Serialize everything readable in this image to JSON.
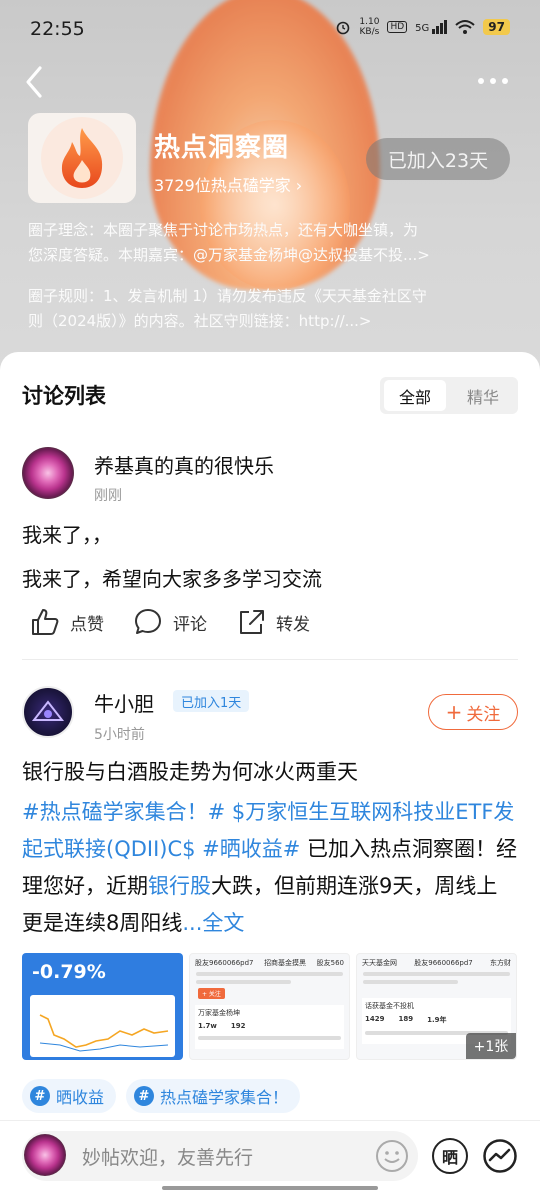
{
  "status_bar": {
    "time": "22:55",
    "speed_value": "1.10",
    "speed_unit": "KB/s",
    "network": "5G",
    "battery": "97"
  },
  "header": {
    "circle_name": "热点洞察圈",
    "members": "3729位热点磕学家 ›",
    "joined": "已加入23天",
    "concept_line1": "圈子理念：本圈子聚焦于讨论市场热点，还有大咖坐镇，为",
    "concept_line2": "您深度答疑。本期嘉宾：@万家基金杨坤@达叔投基不投...>",
    "rules_line1": "圈子规则：1、发言机制 1）请勿发布违反《天天基金社区守",
    "rules_line2": "则（2024版）》的内容。社区守则链接：http://...>"
  },
  "discussion": {
    "title": "讨论列表",
    "tabs": [
      "全部",
      "精华"
    ],
    "active_tab": "全部"
  },
  "post1": {
    "author": "养基真的真的很快乐",
    "time": "刚刚",
    "line1": "我来了，，",
    "line2": "我来了，希望向大家多多学习交流",
    "actions": {
      "like": "点赞",
      "comment": "评论",
      "share": "转发"
    }
  },
  "post2": {
    "author": "牛小胆",
    "badge": "已加入1天",
    "follow": "关注",
    "time": "5小时前",
    "title": "银行股与白酒股走势为何冰火两重天",
    "seg1": "#热点磕学家集合！# $万家恒生互联网科技业ETF发起式联接(QDII)C$ #晒收益#",
    "seg2": " 已加入热点洞察圈！经理您好，近期",
    "seg3": "银行股",
    "seg4": "大跌，但前期连涨9天，周线上更是连续8周阳线",
    "more_link": "...全文",
    "thumb1_value": "-0.79%",
    "image_count": "+1张",
    "tags": [
      "晒收益",
      "热点磕学家集合！"
    ]
  },
  "thumb_text": {
    "t2_user": "股友9660066pd7",
    "t2_col2": "招商基金摸黑",
    "t2_col3": "股友560",
    "t2_btn": "+ 关注",
    "t2_card": "万家基金杨坤",
    "t2_stats": "1.7w",
    "t2_stats2": "192",
    "t3_user": "天天基金网",
    "t3_user2": "股友9660066pd7",
    "t3_user3": "东方财",
    "t3_card": "话获基金不投机",
    "t3_stats": "1429",
    "t3_stats2": "189",
    "t3_stats3": "1.9年"
  },
  "bottom": {
    "placeholder": "妙帖欢迎，友善先行",
    "button_label": "晒"
  },
  "colors": {
    "accent_blue": "#2f86dd",
    "follow_orange": "#f06a3c",
    "flame": "#f26b2d"
  }
}
